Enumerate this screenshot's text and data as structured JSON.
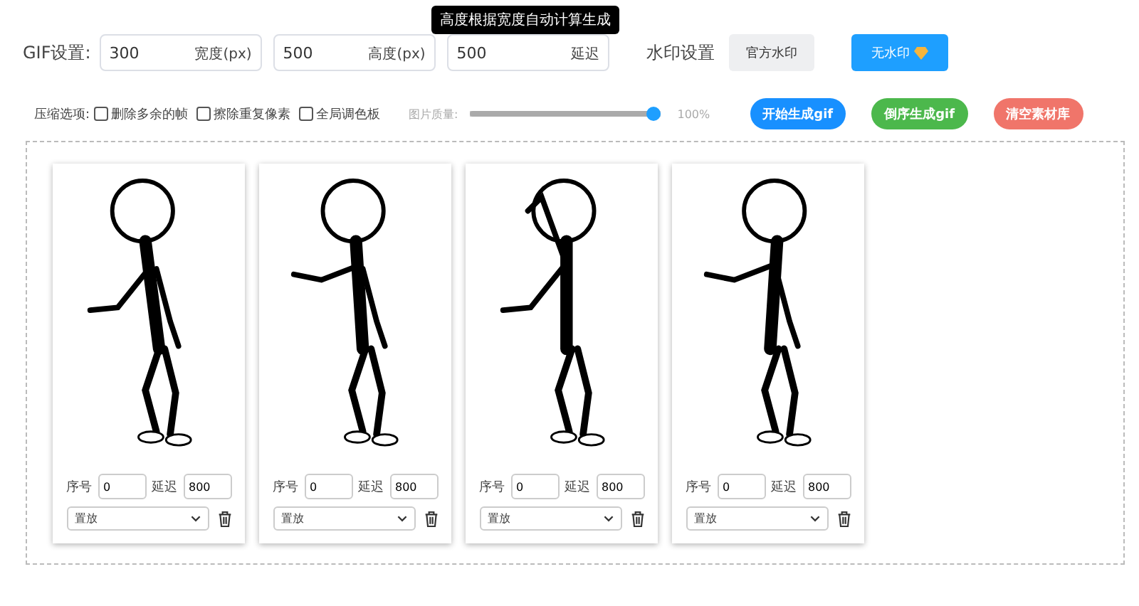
{
  "tooltip": "高度根据宽度自动计算生成",
  "gif_settings": {
    "label": "GIF设置:",
    "fields": [
      {
        "value": "300",
        "suffix": "宽度(px)"
      },
      {
        "value": "500",
        "suffix": "高度(px)"
      },
      {
        "value": "500",
        "suffix": "延迟"
      }
    ]
  },
  "watermark": {
    "label": "水印设置",
    "options": [
      {
        "label": "官方水印",
        "selected": false
      },
      {
        "label": "无水印",
        "selected": true
      }
    ]
  },
  "compression": {
    "label": "压缩选项:",
    "options": [
      {
        "label": "删除多余的帧",
        "checked": false
      },
      {
        "label": "擦除重复像素",
        "checked": false
      },
      {
        "label": "全局调色板",
        "checked": false
      }
    ]
  },
  "quality": {
    "label": "图片质量:",
    "level": 1,
    "reading": "100%"
  },
  "actions": [
    {
      "label": "开始生成gif",
      "color": "#1890ff"
    },
    {
      "label": "倒序生成gif",
      "color": "#4cb84c"
    },
    {
      "label": "清空素材库",
      "color": "#f0756a"
    }
  ],
  "frames": [
    {
      "index_label": "序号",
      "index": "0",
      "delay_label": "延迟",
      "delay": "800",
      "mode": "置放"
    },
    {
      "index_label": "序号",
      "index": "0",
      "delay_label": "延迟",
      "delay": "800",
      "mode": "置放"
    },
    {
      "index_label": "序号",
      "index": "0",
      "delay_label": "延迟",
      "delay": "800",
      "mode": "置放"
    },
    {
      "index_label": "序号",
      "index": "0",
      "delay_label": "延迟",
      "delay": "800",
      "mode": "置放"
    }
  ]
}
